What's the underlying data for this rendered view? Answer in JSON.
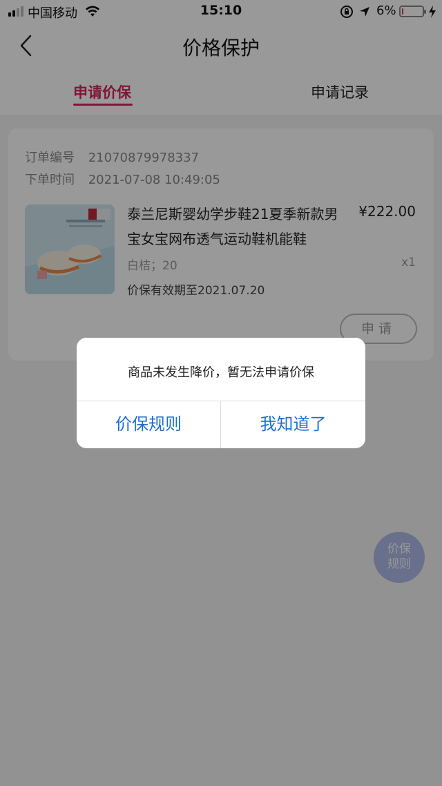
{
  "status_bar": {
    "carrier": "中国移动",
    "time": "15:10",
    "battery_percent": "6%",
    "battery_level": 0.06,
    "battery_color": "#e53935"
  },
  "nav": {
    "title": "价格保护",
    "back_icon": "chevron-left-icon"
  },
  "tabs": [
    {
      "label": "申请价保",
      "active": true
    },
    {
      "label": "申请记录",
      "active": false
    }
  ],
  "order": {
    "order_no_label": "订单编号",
    "order_no": "21070879978337",
    "order_time_label": "下单时间",
    "order_time": "2021-07-08 10:49:05",
    "product_name": "泰兰尼斯婴幼学步鞋21夏季新款男宝女宝网布透气运动鞋机能鞋",
    "price": "¥222.00",
    "spec": "白桔；20",
    "qty": "x1",
    "valid_until": "价保有效期至2021.07.20",
    "apply_button": "申请"
  },
  "float_button": {
    "line1": "价保",
    "line2": "规则"
  },
  "dialog": {
    "message": "商品未发生降价，暂无法申请价保",
    "left_button": "价保规则",
    "right_button": "我知道了"
  },
  "colors": {
    "accent": "#d8245a",
    "dialog_button": "#1d6fcf"
  }
}
